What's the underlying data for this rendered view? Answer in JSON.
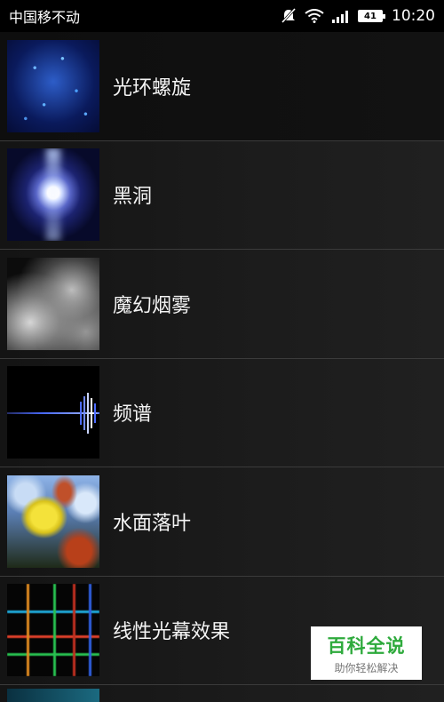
{
  "statusbar": {
    "carrier": "中国移不动",
    "icons": [
      "muted-bell-icon",
      "wifi-icon",
      "signal-icon"
    ],
    "battery": "41",
    "time": "10:20"
  },
  "list": {
    "items": [
      {
        "label": "光环螺旋",
        "thumbnail": "halo-spiral-thumbnail"
      },
      {
        "label": "黑洞",
        "thumbnail": "black-hole-thumbnail"
      },
      {
        "label": "魔幻烟雾",
        "thumbnail": "magic-smoke-thumbnail"
      },
      {
        "label": "频谱",
        "thumbnail": "spectrum-thumbnail"
      },
      {
        "label": "水面落叶",
        "thumbnail": "falling-leaves-thumbnail"
      },
      {
        "label": "线性光幕效果",
        "thumbnail": "linear-light-curtain-thumbnail"
      }
    ]
  },
  "watermark": {
    "title": "百科全说",
    "subtitle": "助你轻松解决"
  }
}
